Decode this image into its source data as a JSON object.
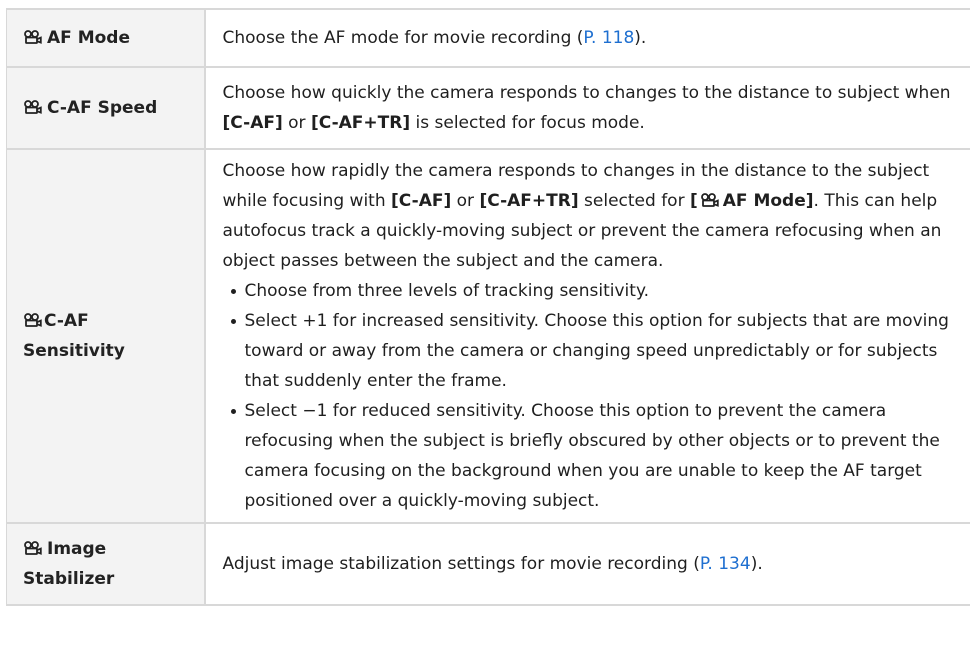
{
  "rows": [
    {
      "name": "AF Mode",
      "desc_pre": "Choose the AF mode for movie recording (",
      "link": "P. 118",
      "desc_post": ")."
    },
    {
      "name": "C-AF Speed",
      "desc_1": "Choose how quickly the camera responds to changes to the distance to subject when ",
      "b1": "[C-AF]",
      "or": " or ",
      "b2": "[C-AF+TR]",
      "desc_2": " is selected for focus mode."
    },
    {
      "name_1": "C-AF",
      "name_2": "Sensitivity",
      "desc_1": "Choose how rapidly the camera responds to changes in the distance to the subject while focusing with ",
      "b1": "[C-AF]",
      "or": " or ",
      "b2": "[C-AF+TR]",
      "mid": " selected for ",
      "b3_open": "[",
      "b3_text": "AF Mode]",
      "desc_2": ". This can help autofocus track a quickly-moving subject or prevent the camera refocusing when an object passes between the subject and the camera.",
      "bullets": [
        "Choose from three levels of tracking sensitivity.",
        "Select +1 for increased sensitivity. Choose this option for subjects that are moving toward or away from the camera or changing speed unpredictably or for subjects that suddenly enter the frame.",
        "Select −1 for reduced sensitivity. Choose this option to prevent the camera refocusing when the subject is briefly obscured by other objects or to prevent the camera focusing on the background when you are unable to keep the AF target positioned over a quickly-moving subject."
      ]
    },
    {
      "name_1": "Image",
      "name_2": "Stabilizer",
      "desc_pre": "Adjust image stabilization settings for movie recording (",
      "link": "P. 134",
      "desc_post": ")."
    }
  ],
  "icon": "movie-camera-icon",
  "colors": {
    "link": "#1e6fd0",
    "header_bg": "#f3f3f3",
    "border": "#d8d8d8"
  }
}
